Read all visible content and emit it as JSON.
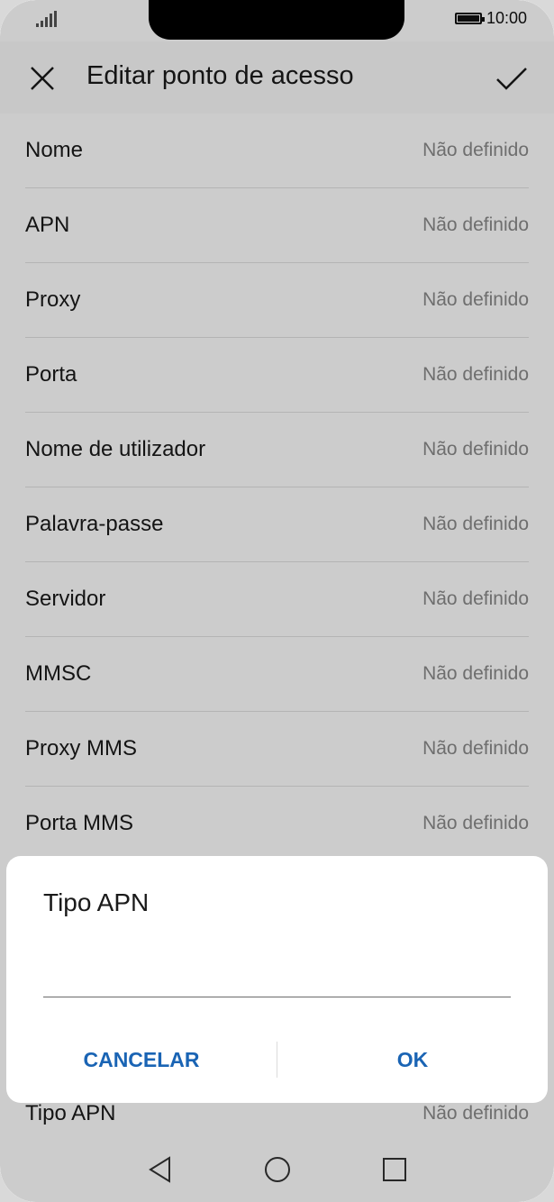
{
  "status_bar": {
    "time": "10:00",
    "signal_icon": "signal-icon",
    "battery_icon": "battery-icon"
  },
  "app_bar": {
    "title": "Editar ponto de acesso",
    "close_icon": "close-icon",
    "confirm_icon": "check-icon"
  },
  "fields": [
    {
      "label": "Nome",
      "value": "Não definido"
    },
    {
      "label": "APN",
      "value": "Não definido"
    },
    {
      "label": "Proxy",
      "value": "Não definido"
    },
    {
      "label": "Porta",
      "value": "Não definido"
    },
    {
      "label": "Nome de utilizador",
      "value": "Não definido"
    },
    {
      "label": "Palavra-passe",
      "value": "Não definido"
    },
    {
      "label": "Servidor",
      "value": "Não definido"
    },
    {
      "label": "MMSC",
      "value": "Não definido"
    },
    {
      "label": "Proxy MMS",
      "value": "Não definido"
    },
    {
      "label": "Porta MMS",
      "value": "Não definido"
    }
  ],
  "tipo_apn_row": {
    "label": "Tipo APN",
    "value": "Não definido"
  },
  "dialog": {
    "title": "Tipo APN",
    "input_value": "",
    "cancel_label": "CANCELAR",
    "ok_label": "OK",
    "accent_color": "#1a64b4"
  },
  "nav_bar": {
    "back_icon": "back-triangle-icon",
    "home_icon": "home-circle-icon",
    "recents_icon": "recents-square-icon"
  }
}
